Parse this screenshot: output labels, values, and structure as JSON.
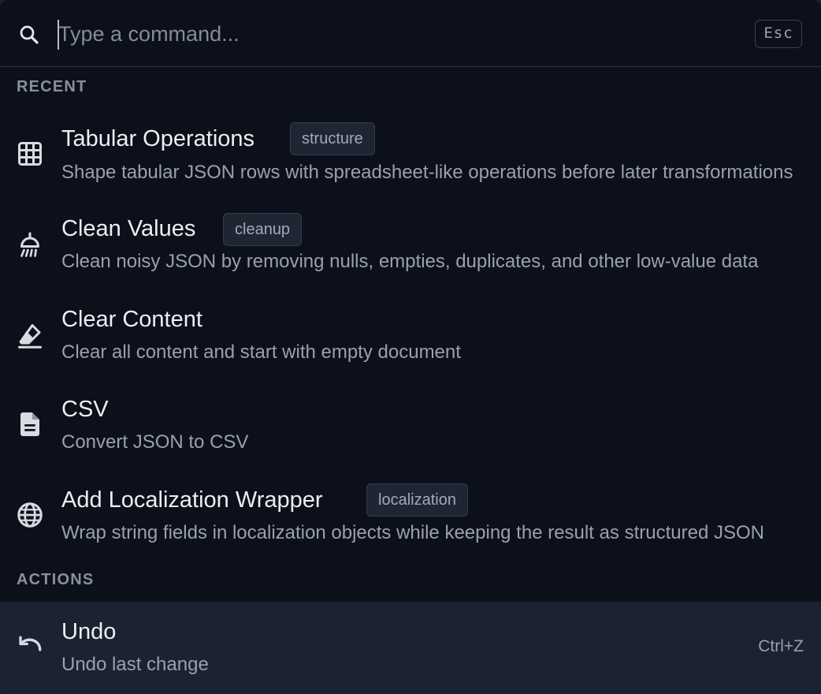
{
  "search": {
    "placeholder": "Type a command...",
    "value": "",
    "esc_label": "Esc"
  },
  "sections": {
    "recent_label": "RECENT",
    "actions_label": "ACTIONS"
  },
  "recent": [
    {
      "title": "Tabular Operations",
      "tag": "structure",
      "description": "Shape tabular JSON rows with spreadsheet-like operations before later transformations",
      "icon": "table-icon"
    },
    {
      "title": "Clean Values",
      "tag": "cleanup",
      "description": "Clean noisy JSON by removing nulls, empties, duplicates, and other low-value data",
      "icon": "shower-icon"
    },
    {
      "title": "Clear Content",
      "tag": "",
      "description": "Clear all content and start with empty document",
      "icon": "eraser-icon"
    },
    {
      "title": "CSV",
      "tag": "",
      "description": "Convert JSON to CSV",
      "icon": "document-icon"
    },
    {
      "title": "Add Localization Wrapper",
      "tag": "localization",
      "description": "Wrap string fields in localization objects while keeping the result as structured JSON",
      "icon": "globe-icon"
    }
  ],
  "actions": [
    {
      "title": "Undo",
      "description": "Undo last change",
      "shortcut": "Ctrl+Z",
      "icon": "undo-icon",
      "selected": true
    }
  ],
  "colors": {
    "background": "#0c101b",
    "selected_row": "#1c2232",
    "tag_background": "#1f2533",
    "text_primary": "#eceef2",
    "text_secondary": "#9aa0ac"
  }
}
